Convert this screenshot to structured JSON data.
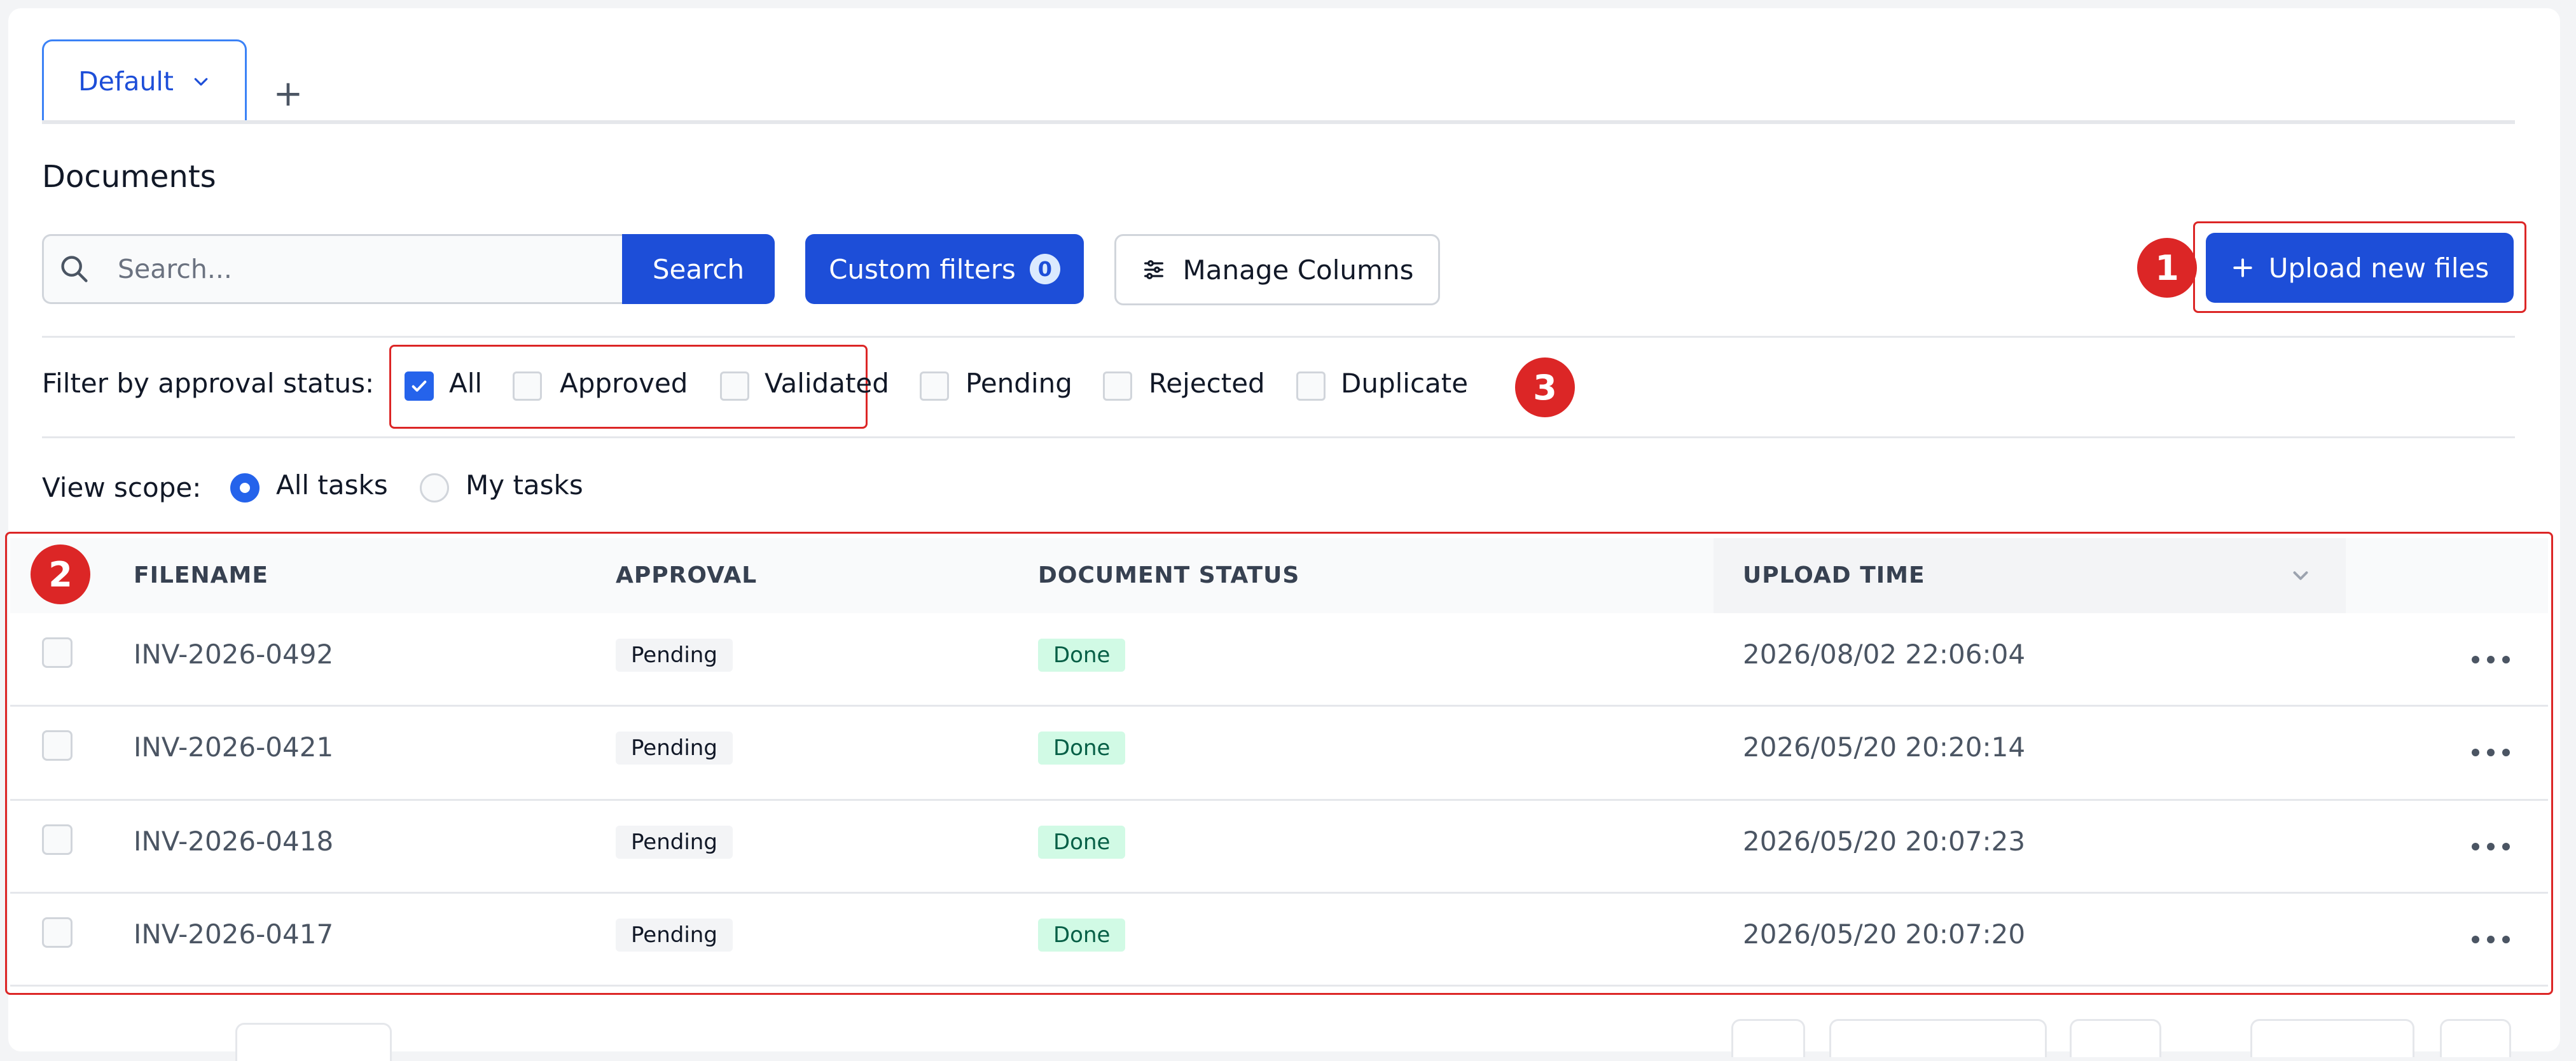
{
  "tabs": {
    "items": [
      {
        "label": "Default"
      }
    ],
    "add_label": "+"
  },
  "page": {
    "title": "Documents"
  },
  "search": {
    "placeholder": "Search...",
    "button_label": "Search"
  },
  "toolbar": {
    "custom_filters_label": "Custom filters",
    "custom_filters_count": "0",
    "manage_columns_label": "Manage Columns",
    "upload_label": "Upload new files"
  },
  "markers": {
    "upload": "1",
    "table": "2",
    "filters": "3"
  },
  "approval_filter": {
    "label": "Filter by approval status:",
    "options": [
      {
        "label": "All",
        "checked": true
      },
      {
        "label": "Approved",
        "checked": false
      },
      {
        "label": "Validated",
        "checked": false
      },
      {
        "label": "Pending",
        "checked": false
      },
      {
        "label": "Rejected",
        "checked": false
      },
      {
        "label": "Duplicate",
        "checked": false
      }
    ]
  },
  "view_scope": {
    "label": "View scope:",
    "options": [
      {
        "label": "All tasks",
        "selected": true
      },
      {
        "label": "My tasks",
        "selected": false
      }
    ]
  },
  "table": {
    "columns": [
      "FILENAME",
      "APPROVAL",
      "DOCUMENT STATUS",
      "UPLOAD TIME"
    ],
    "sorted_column": "UPLOAD TIME",
    "rows": [
      {
        "filename": "INV-2026-0492",
        "approval": "Pending",
        "status": "Done",
        "upload_time": "2026/08/02 22:06:04"
      },
      {
        "filename": "INV-2026-0421",
        "approval": "Pending",
        "status": "Done",
        "upload_time": "2026/05/20 20:20:14"
      },
      {
        "filename": "INV-2026-0418",
        "approval": "Pending",
        "status": "Done",
        "upload_time": "2026/05/20 20:07:23"
      },
      {
        "filename": "INV-2026-0417",
        "approval": "Pending",
        "status": "Done",
        "upload_time": "2026/05/20 20:07:20"
      }
    ]
  },
  "colors": {
    "primary": "#1d4ed8",
    "highlight": "#dc2626",
    "done_bg": "#d1fae5",
    "done_text": "#065f46",
    "pending_bg": "#f3f4f6"
  },
  "icons": {
    "search": "search-icon",
    "chevron": "chevron-down-icon",
    "plus": "plus-icon",
    "sliders": "sliders-icon",
    "more": "more-horizontal-icon",
    "check": "check-icon"
  }
}
